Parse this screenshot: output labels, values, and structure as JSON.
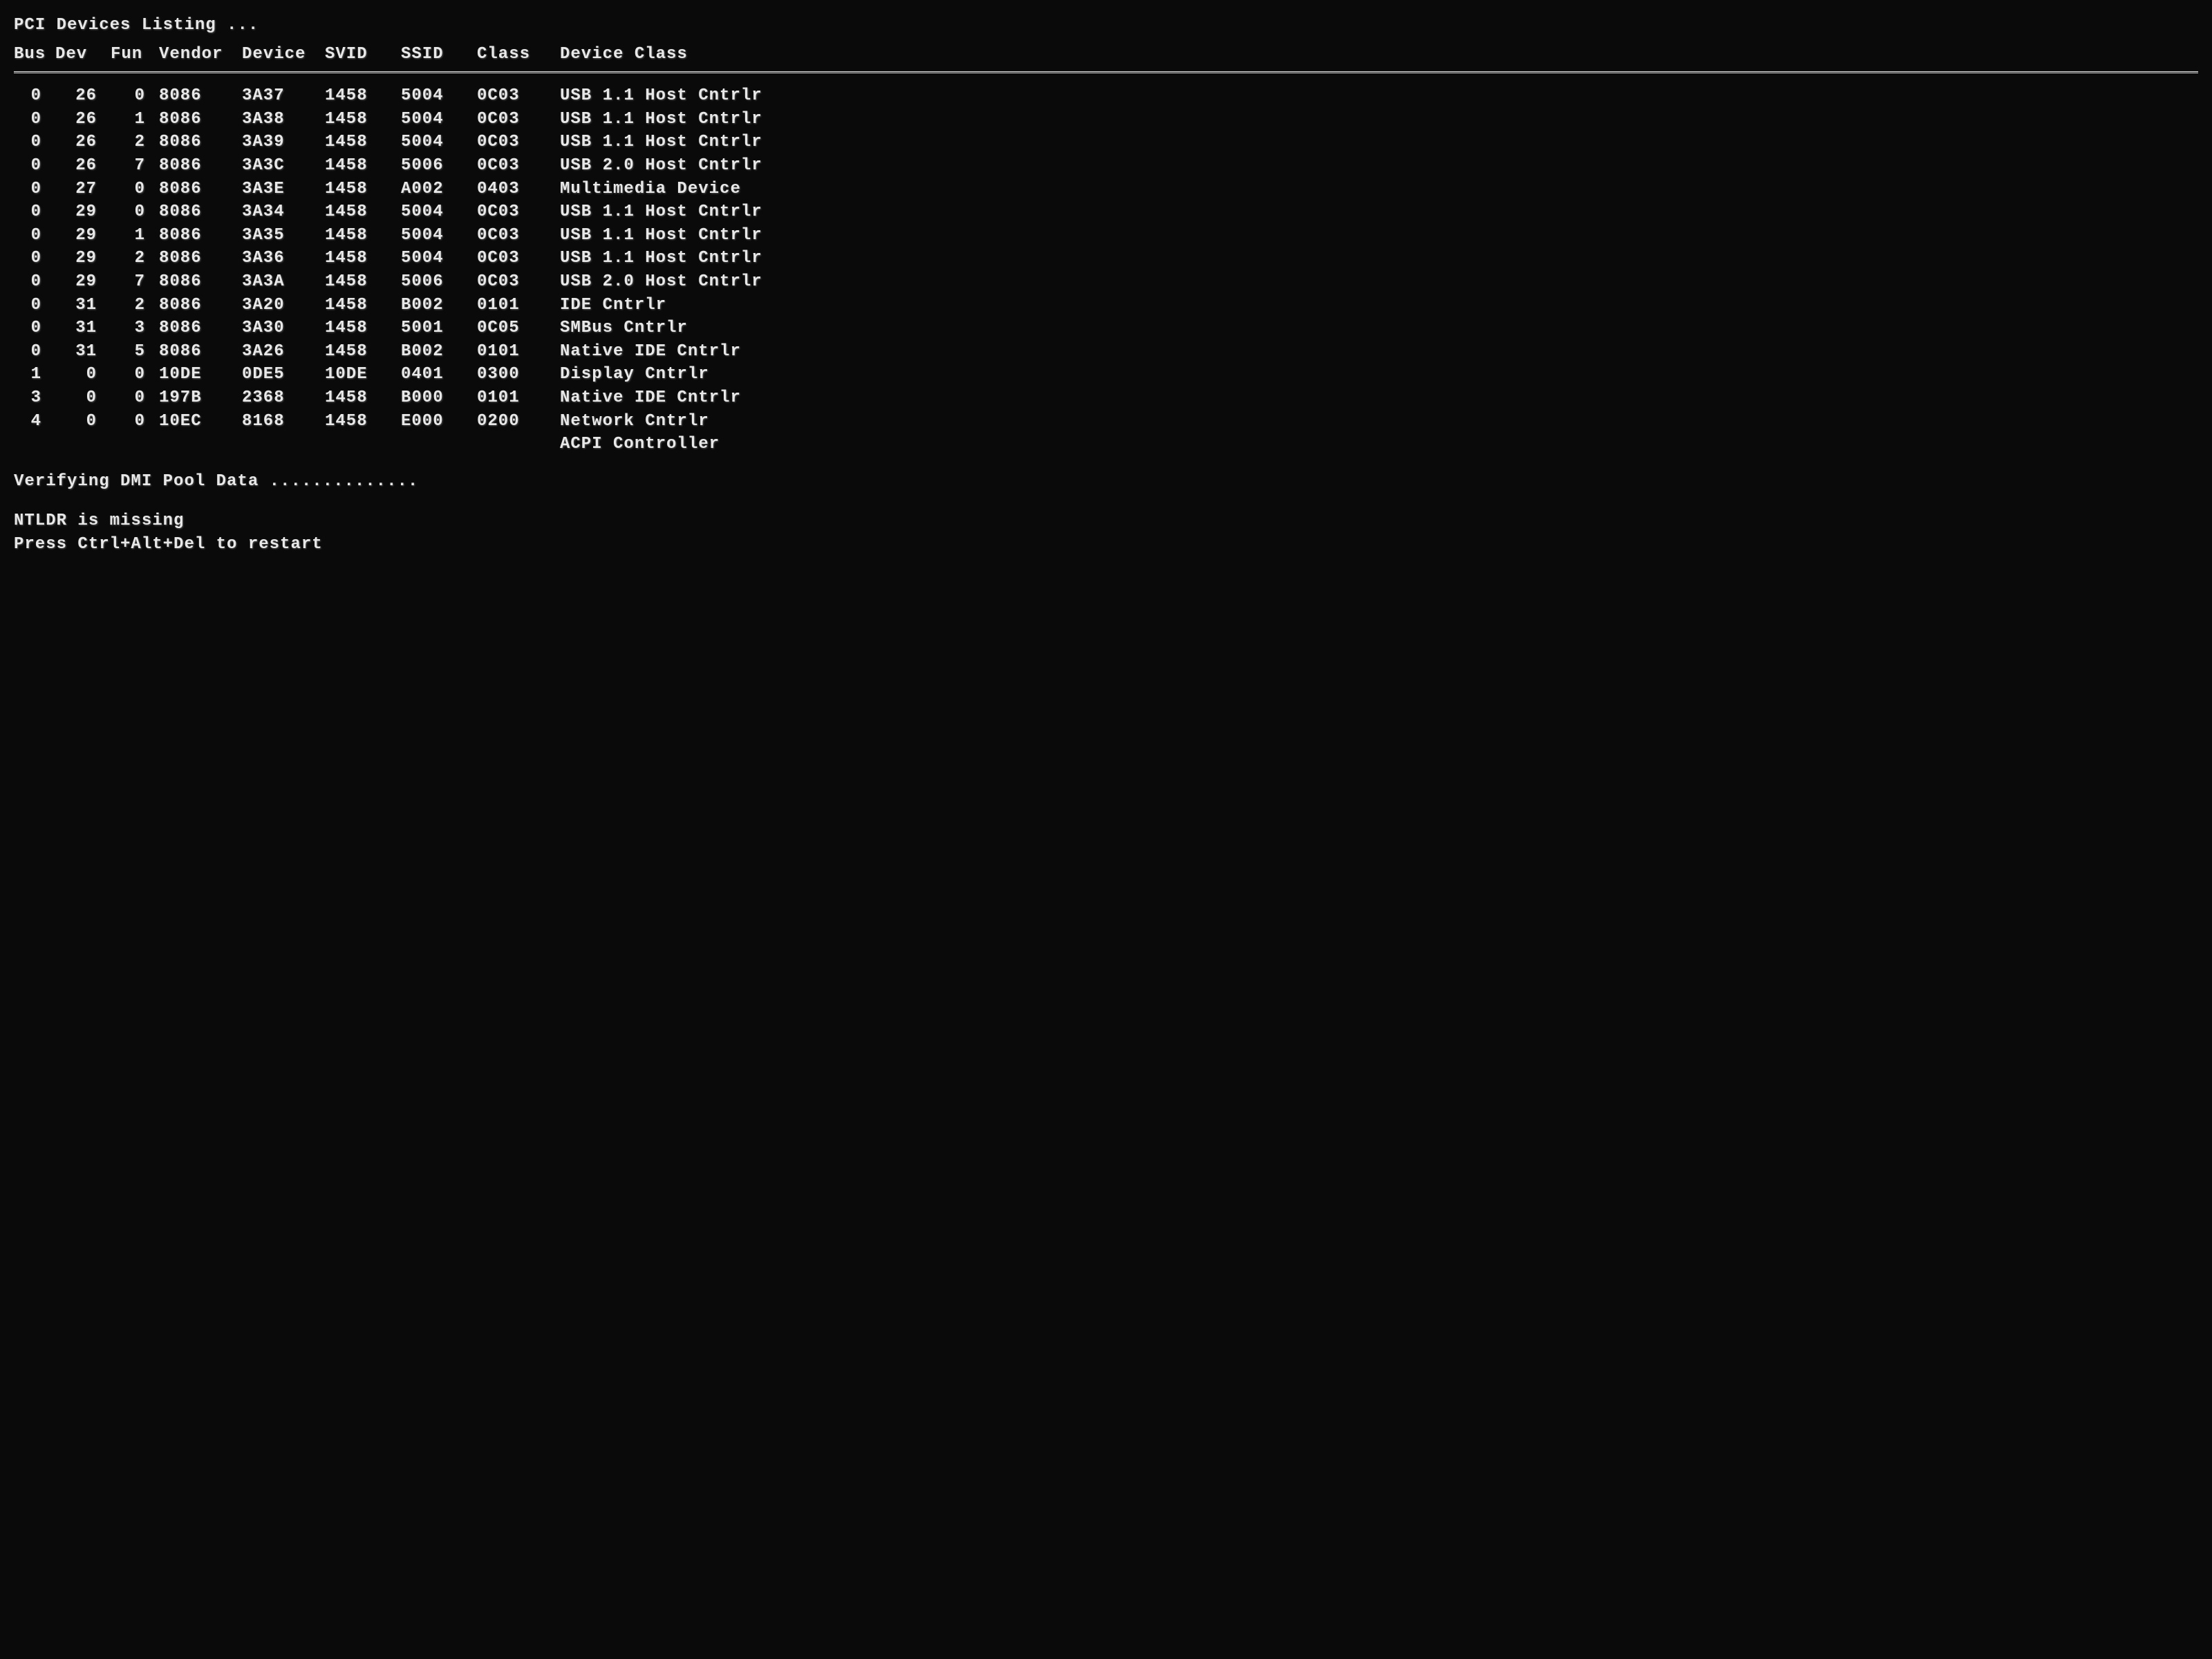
{
  "title": "PCI Devices Listing ...",
  "headers": {
    "bus": "Bus",
    "dev": "Dev",
    "fun": "Fun",
    "vendor": "Vendor",
    "device": "Device",
    "svid": "SVID",
    "ssid": "SSID",
    "class": "Class",
    "devclass": "Device Class"
  },
  "rows": [
    {
      "bus": "0",
      "dev": "26",
      "fun": "0",
      "vendor": "8086",
      "device": "3A37",
      "svid": "1458",
      "ssid": "5004",
      "class": "0C03",
      "devclass": "USB 1.1 Host Cntrlr"
    },
    {
      "bus": "0",
      "dev": "26",
      "fun": "1",
      "vendor": "8086",
      "device": "3A38",
      "svid": "1458",
      "ssid": "5004",
      "class": "0C03",
      "devclass": "USB 1.1 Host Cntrlr"
    },
    {
      "bus": "0",
      "dev": "26",
      "fun": "2",
      "vendor": "8086",
      "device": "3A39",
      "svid": "1458",
      "ssid": "5004",
      "class": "0C03",
      "devclass": "USB 1.1 Host Cntrlr"
    },
    {
      "bus": "0",
      "dev": "26",
      "fun": "7",
      "vendor": "8086",
      "device": "3A3C",
      "svid": "1458",
      "ssid": "5006",
      "class": "0C03",
      "devclass": "USB 2.0 Host Cntrlr"
    },
    {
      "bus": "0",
      "dev": "27",
      "fun": "0",
      "vendor": "8086",
      "device": "3A3E",
      "svid": "1458",
      "ssid": "A002",
      "class": "0403",
      "devclass": "Multimedia Device"
    },
    {
      "bus": "0",
      "dev": "29",
      "fun": "0",
      "vendor": "8086",
      "device": "3A34",
      "svid": "1458",
      "ssid": "5004",
      "class": "0C03",
      "devclass": "USB 1.1 Host Cntrlr"
    },
    {
      "bus": "0",
      "dev": "29",
      "fun": "1",
      "vendor": "8086",
      "device": "3A35",
      "svid": "1458",
      "ssid": "5004",
      "class": "0C03",
      "devclass": "USB 1.1 Host Cntrlr"
    },
    {
      "bus": "0",
      "dev": "29",
      "fun": "2",
      "vendor": "8086",
      "device": "3A36",
      "svid": "1458",
      "ssid": "5004",
      "class": "0C03",
      "devclass": "USB 1.1 Host Cntrlr"
    },
    {
      "bus": "0",
      "dev": "29",
      "fun": "7",
      "vendor": "8086",
      "device": "3A3A",
      "svid": "1458",
      "ssid": "5006",
      "class": "0C03",
      "devclass": "USB 2.0 Host Cntrlr"
    },
    {
      "bus": "0",
      "dev": "31",
      "fun": "2",
      "vendor": "8086",
      "device": "3A20",
      "svid": "1458",
      "ssid": "B002",
      "class": "0101",
      "devclass": "IDE Cntrlr"
    },
    {
      "bus": "0",
      "dev": "31",
      "fun": "3",
      "vendor": "8086",
      "device": "3A30",
      "svid": "1458",
      "ssid": "5001",
      "class": "0C05",
      "devclass": "SMBus Cntrlr"
    },
    {
      "bus": "0",
      "dev": "31",
      "fun": "5",
      "vendor": "8086",
      "device": "3A26",
      "svid": "1458",
      "ssid": "B002",
      "class": "0101",
      "devclass": "Native IDE Cntrlr"
    },
    {
      "bus": "1",
      "dev": "0",
      "fun": "0",
      "vendor": "10DE",
      "device": "0DE5",
      "svid": "10DE",
      "ssid": "0401",
      "class": "0300",
      "devclass": "Display Cntrlr"
    },
    {
      "bus": "3",
      "dev": "0",
      "fun": "0",
      "vendor": "197B",
      "device": "2368",
      "svid": "1458",
      "ssid": "B000",
      "class": "0101",
      "devclass": "Native IDE Cntrlr"
    },
    {
      "bus": "4",
      "dev": "0",
      "fun": "0",
      "vendor": "10EC",
      "device": "8168",
      "svid": "1458",
      "ssid": "E000",
      "class": "0200",
      "devclass": "Network Cntrlr"
    },
    {
      "bus": "",
      "dev": "",
      "fun": "",
      "vendor": "",
      "device": "",
      "svid": "",
      "ssid": "",
      "class": "",
      "devclass": "ACPI Controller"
    }
  ],
  "footer": {
    "verify": "Verifying DMI Pool Data ..............",
    "error": "NTLDR is missing",
    "restart": "Press Ctrl+Alt+Del to restart"
  }
}
